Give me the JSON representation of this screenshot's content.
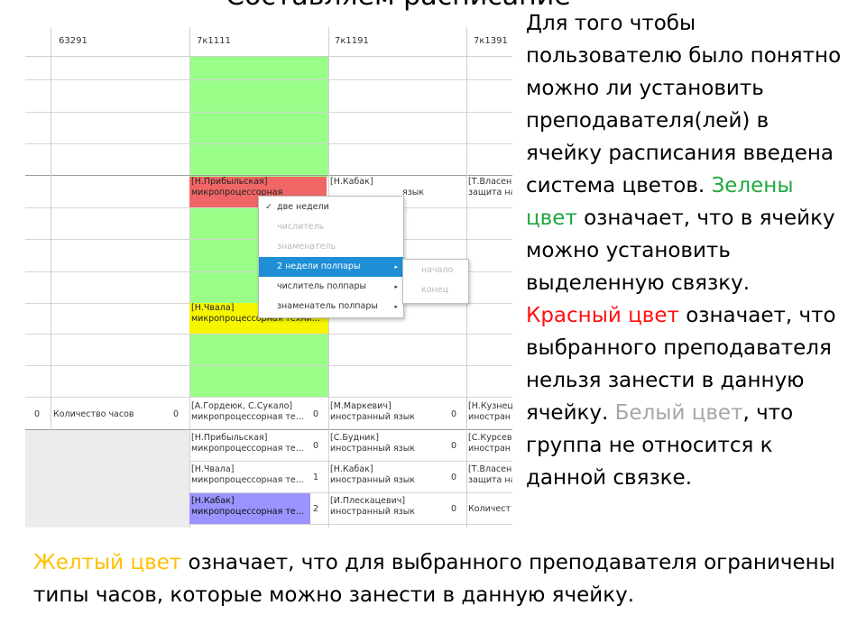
{
  "title": "Составляем расписание",
  "table": {
    "header": [
      "63291",
      "7к1111",
      "7к1191",
      "7к1391"
    ],
    "cells": {
      "red_cell": [
        "[Н.Прибыльская]",
        "микропроцессорная"
      ],
      "kabak_cell": [
        "[Н.Кабак]",
        "язык"
      ],
      "vlasen_cell": [
        "[Т.Власен",
        "защита на"
      ],
      "yellow_cell": [
        "[Н.Чвала]",
        "микропроцессорная техни..."
      ]
    },
    "summary_rows": [
      {
        "n0": "0",
        "label": "Количество часов",
        "n1": "0",
        "c1a": "[А.Гордеюк, С.Сукало]",
        "c1b": "микропроцессорная те...",
        "n2": "0",
        "c2a": "[М.Маркевич]",
        "c2b": "иностранный язык",
        "n3": "0",
        "c3a": "[Н.Кузнец",
        "c3b": "иностран"
      },
      {
        "n0": "",
        "label": "",
        "n1": "",
        "c1a": "[Н.Прибыльская]",
        "c1b": "микропроцессорная те...",
        "n2": "0",
        "c2a": "[С.Будник]",
        "c2b": "иностранный язык",
        "n3": "0",
        "c3a": "[С.Курсев",
        "c3b": "иностран"
      },
      {
        "n0": "",
        "label": "",
        "n1": "",
        "c1a": "[Н.Чвала]",
        "c1b": "микропроцессорная те...",
        "n2": "1",
        "c2a": "[Н.Кабак]",
        "c2b": "иностранный язык",
        "n3": "0",
        "c3a": "[Т.Власен",
        "c3b": "защита на"
      },
      {
        "n0": "",
        "label": "",
        "n1": "",
        "c1a": "[Н.Кабак]",
        "c1b": "микропроцессорная те...",
        "n2": "2",
        "c2a": "[И.Плескацевич]",
        "c2b": "иностранный язык",
        "n3": "0",
        "c3a": "Количест",
        "c3b": ""
      }
    ]
  },
  "context_menu": {
    "items": [
      {
        "label": "две недели",
        "check": "✓"
      },
      {
        "label": "числитель"
      },
      {
        "label": "знаменатель"
      },
      {
        "label": "2 недели полпары",
        "arrow": "▸"
      },
      {
        "label": "числитель полпары",
        "arrow": "▸"
      },
      {
        "label": "знаменатель полпары",
        "arrow": "▸"
      }
    ],
    "submenu": [
      "начало",
      "конец"
    ]
  },
  "explanation": {
    "intro": "Для того чтобы пользователю было понятно можно ли установить преподавателя(лей) в ячейку расписания введена система цветов.",
    "green_word": "Зелены цвет",
    "green_rest": " означает, что в ячейку можно установить выделенную связку.",
    "red_word": "Красный цвет",
    "red_rest": " означает, что выбранного преподавателя нельзя занести в данную ячейку.",
    "white_word": "Белый цвет",
    "white_rest": ", что группа не относится к данной связке.",
    "yellow_word": "Желтый цвет",
    "yellow_rest": " означает, что для выбранного преподавателя ограничены типы часов, которые можно занести в данную ячейку."
  },
  "colors": {
    "green": "#99ff88",
    "red": "#f06666",
    "yellow": "#f7f500",
    "violet": "#9b93ff",
    "menu_selected": "#1e8fd5"
  }
}
